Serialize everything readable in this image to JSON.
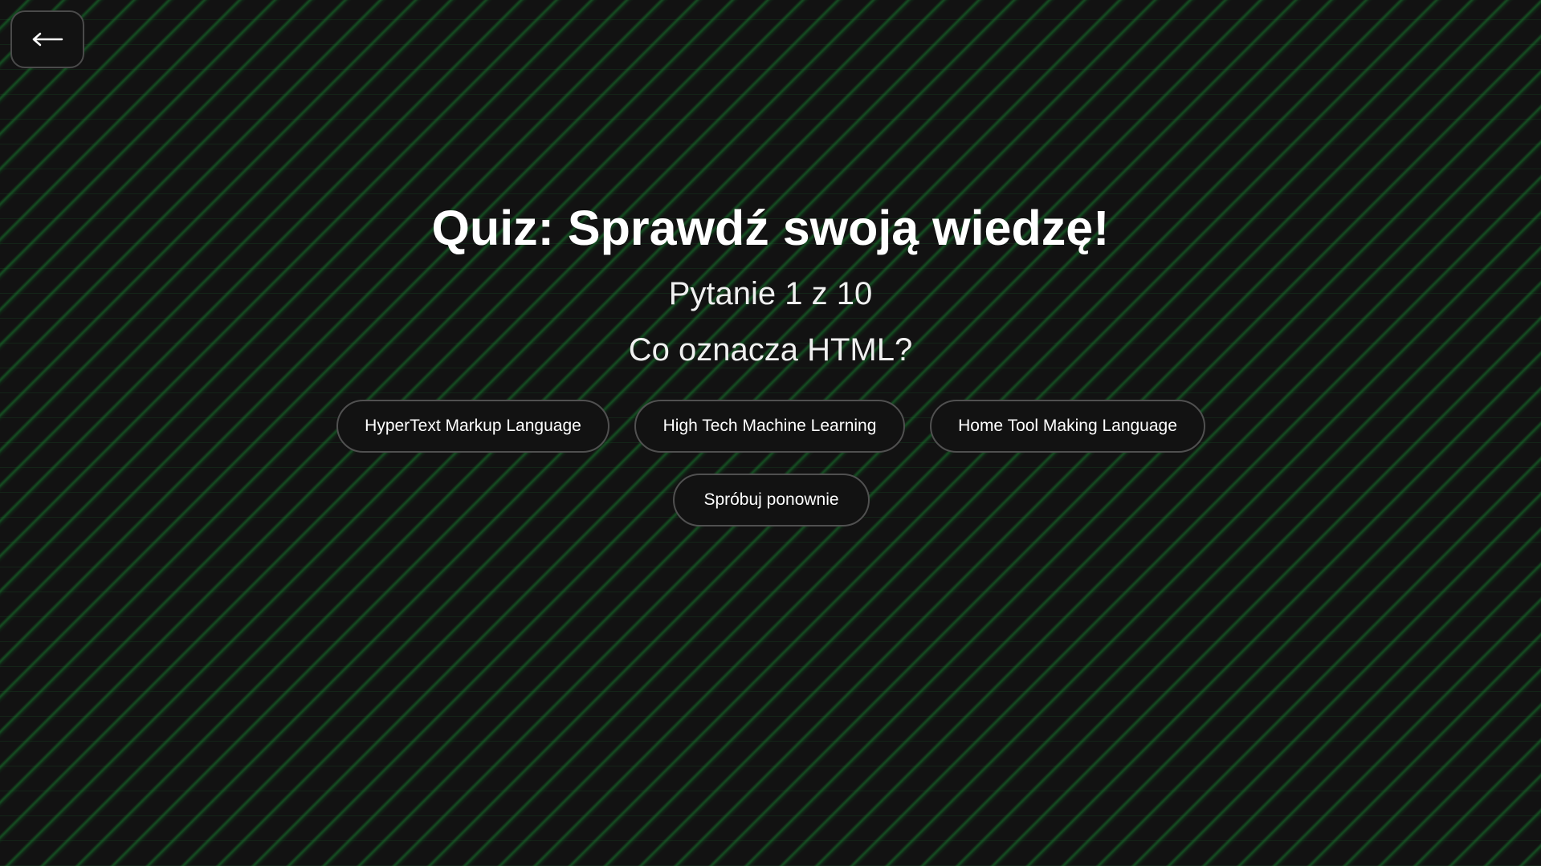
{
  "navigation": {
    "back_icon": "arrow-left-icon"
  },
  "quiz": {
    "title": "Quiz: Sprawdź swoją wiedzę!",
    "progress": "Pytanie 1 z 10",
    "question": "Co oznacza HTML?",
    "answers": [
      {
        "label": "HyperText Markup Language"
      },
      {
        "label": "High Tech Machine Learning"
      },
      {
        "label": "Home Tool Making Language"
      }
    ],
    "retry_label": "Spróbuj ponownie"
  },
  "colors": {
    "background": "#121212",
    "pattern_accent": "#18822f",
    "button_border": "#505050",
    "text": "#ffffff"
  }
}
